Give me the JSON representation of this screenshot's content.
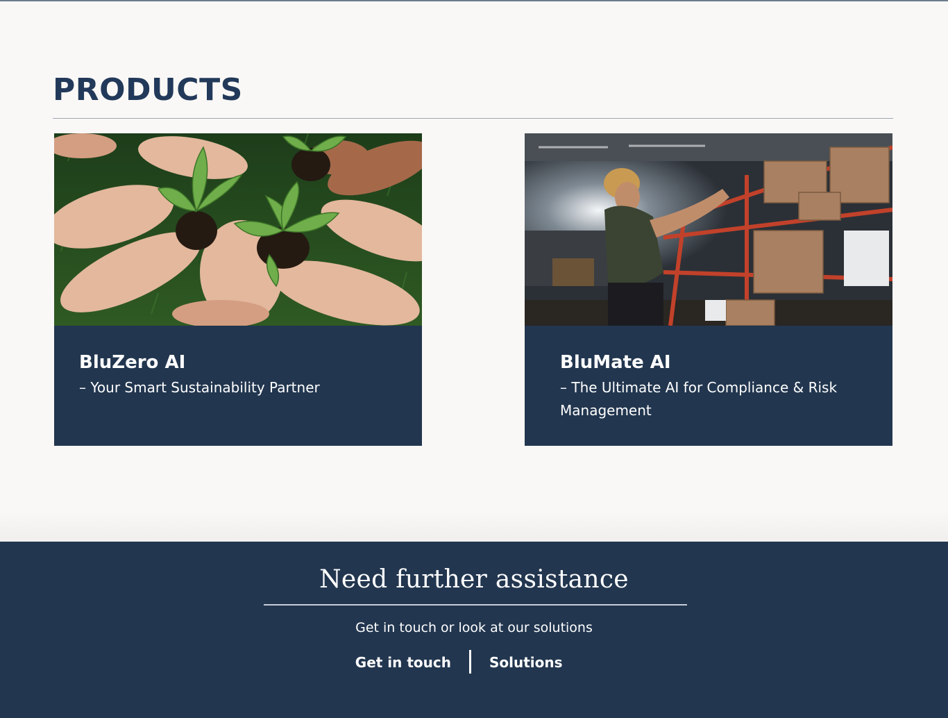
{
  "section": {
    "title": "PRODUCTS"
  },
  "products": [
    {
      "name": "BluZero AI",
      "tagline": "– Your Smart Sustainability Partner",
      "image": "hands-holding-seedlings-photo"
    },
    {
      "name": "BluMate AI",
      "tagline": "– The Ultimate AI for Compliance & Risk Management",
      "image": "warehouse-worker-shelves-photo"
    }
  ],
  "footer": {
    "heading": "Need further assistance",
    "subtext": "Get in touch or look at our solutions",
    "links": {
      "contact": "Get in touch",
      "solutions": "Solutions"
    }
  },
  "colors": {
    "page_background": "#faf8f6",
    "brand_navy": "#22364f",
    "title_blue": "#22395a",
    "text_on_dark": "#ffffff"
  }
}
